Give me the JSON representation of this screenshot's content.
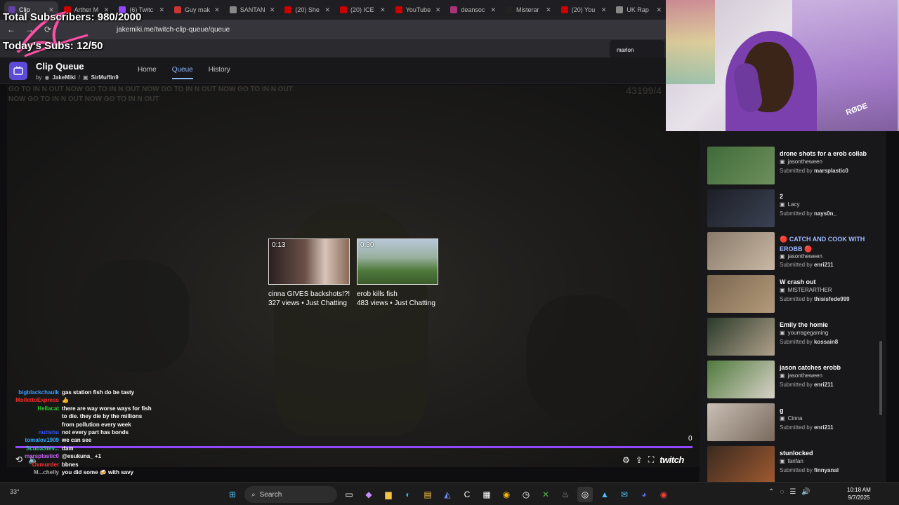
{
  "browser": {
    "tabs": [
      {
        "label": "Clip",
        "color": "#6441a5",
        "active": true
      },
      {
        "label": "Arther M",
        "color": "#cc0000"
      },
      {
        "label": "(6) Twitc",
        "color": "#9147ff"
      },
      {
        "label": "Guy mak",
        "color": "#cc3333"
      },
      {
        "label": "SANTAN",
        "color": "#888888"
      },
      {
        "label": "(20) She",
        "color": "#cc0000"
      },
      {
        "label": "(20) ICE",
        "color": "#cc0000"
      },
      {
        "label": "YouTube",
        "color": "#cc0000"
      },
      {
        "label": "deansoc",
        "color": "#aa3377"
      },
      {
        "label": "Misterar",
        "color": "#222222"
      },
      {
        "label": "(20) You",
        "color": "#cc0000"
      },
      {
        "label": "UK Rap",
        "color": "#888888"
      }
    ],
    "url": "jakemiki.me/twitch-clip-queue/queue",
    "profile_name": "marlon"
  },
  "overlay": {
    "total_subscribers": "Total Subscribers: 980/2000",
    "todays_subs": "Today's Subs: 12/50"
  },
  "app": {
    "title": "Clip Queue",
    "by": "by",
    "author1": "JakeMiki",
    "separator": "/",
    "author2": "SirMuffin9",
    "nav": [
      {
        "label": "Home"
      },
      {
        "label": "Queue",
        "active": true
      },
      {
        "label": "History"
      }
    ]
  },
  "video": {
    "ghost_text": "GO TO IN N OUT NOW GO TO IN N OUT NOW GO TO IN N OUT NOW GO TO IN N OUT NOW GO TO IN N OUT NOW GO TO IN N OUT",
    "ghost_number": "43199/4",
    "progress_count": "0",
    "suggestions": [
      {
        "duration": "0:13",
        "title": "cinna GIVES backshots!?!...",
        "meta": "327 views • Just Chatting"
      },
      {
        "duration": "0:30",
        "title": "erob kills fish",
        "meta": "483 views • Just Chatting"
      }
    ],
    "brand": "twitch"
  },
  "chat": [
    {
      "user": "bigblackchaulk",
      "color": "#3d9bff",
      "msg": "gas station fish do be tasty"
    },
    {
      "user": "MollettoExpress",
      "color": "#ff2a2a",
      "msg": "👍"
    },
    {
      "user": "Hellacat",
      "color": "#33cc33",
      "msg": "there are way worse ways for fish to die. they die by the millions from pollution every week"
    },
    {
      "user": "nuttsbu",
      "color": "#3355ff",
      "msg": "not every part has bonds"
    },
    {
      "user": "tomalov1909",
      "color": "#33aaff",
      "msg": "we can see"
    },
    {
      "user": "ScubaStev...",
      "color": "#33cc99",
      "msg": "dam"
    },
    {
      "user": "marsplastic0",
      "color": "#cc66ff",
      "msg": "@esukuna_ +1"
    },
    {
      "user": "Oxmurder",
      "color": "#ff3333",
      "msg": "bbnes"
    },
    {
      "user": "M...chelly",
      "color": "#aaaaaa",
      "msg": "you did some 🍻 with savy"
    }
  ],
  "queue": [
    {
      "title": "drone shots for a erob collab",
      "channel": "jasontheween",
      "submitted_prefix": "Submitted by",
      "submitter": "marsplastic0",
      "thumb": [
        "#3f6b3a",
        "#6e8f5c"
      ]
    },
    {
      "title": "2",
      "channel": "Lacy",
      "submitted_prefix": "Submitted by",
      "submitter": "nays0n_",
      "thumb": [
        "#1d1f26",
        "#3a4152"
      ]
    },
    {
      "title": "🔴 CATCH AND COOK WITH EROBB 🔴",
      "channel": "jasontheween",
      "submitted_prefix": "Submitted by",
      "submitter": "enri211",
      "highlight": true,
      "thumb": [
        "#8a7a6a",
        "#c9b8a4"
      ]
    },
    {
      "title": "W crash out",
      "channel": "MISTERARTHER",
      "submitted_prefix": "Submitted by",
      "submitter": "thisisfede999",
      "thumb": [
        "#7a6650",
        "#b49a7a"
      ]
    },
    {
      "title": "Emily the homie",
      "channel": "yourragegaming",
      "submitted_prefix": "Submitted by",
      "submitter": "kossain8",
      "thumb": [
        "#2a3a2a",
        "#b0a08a"
      ]
    },
    {
      "title": "jason catches erobb",
      "channel": "jasontheween",
      "submitted_prefix": "Submitted by",
      "submitter": "enri211",
      "thumb": [
        "#4f7a3c",
        "#d8d2c8"
      ]
    },
    {
      "title": "g",
      "channel": "Cinna",
      "submitted_prefix": "Submitted by",
      "submitter": "enri211",
      "thumb": [
        "#c9bfb4",
        "#7a6a5e"
      ]
    },
    {
      "title": "stunlocked",
      "channel": "fanfan",
      "submitted_prefix": "Submitted by",
      "submitter": "finnyanal",
      "thumb": [
        "#3a2a20",
        "#a05a30"
      ]
    }
  ],
  "webcam": {
    "mic_brand": "RØDE"
  },
  "taskbar": {
    "search_placeholder": "Search",
    "weather": "33°",
    "time": "10:18 AM",
    "date": "9/7/2025"
  }
}
